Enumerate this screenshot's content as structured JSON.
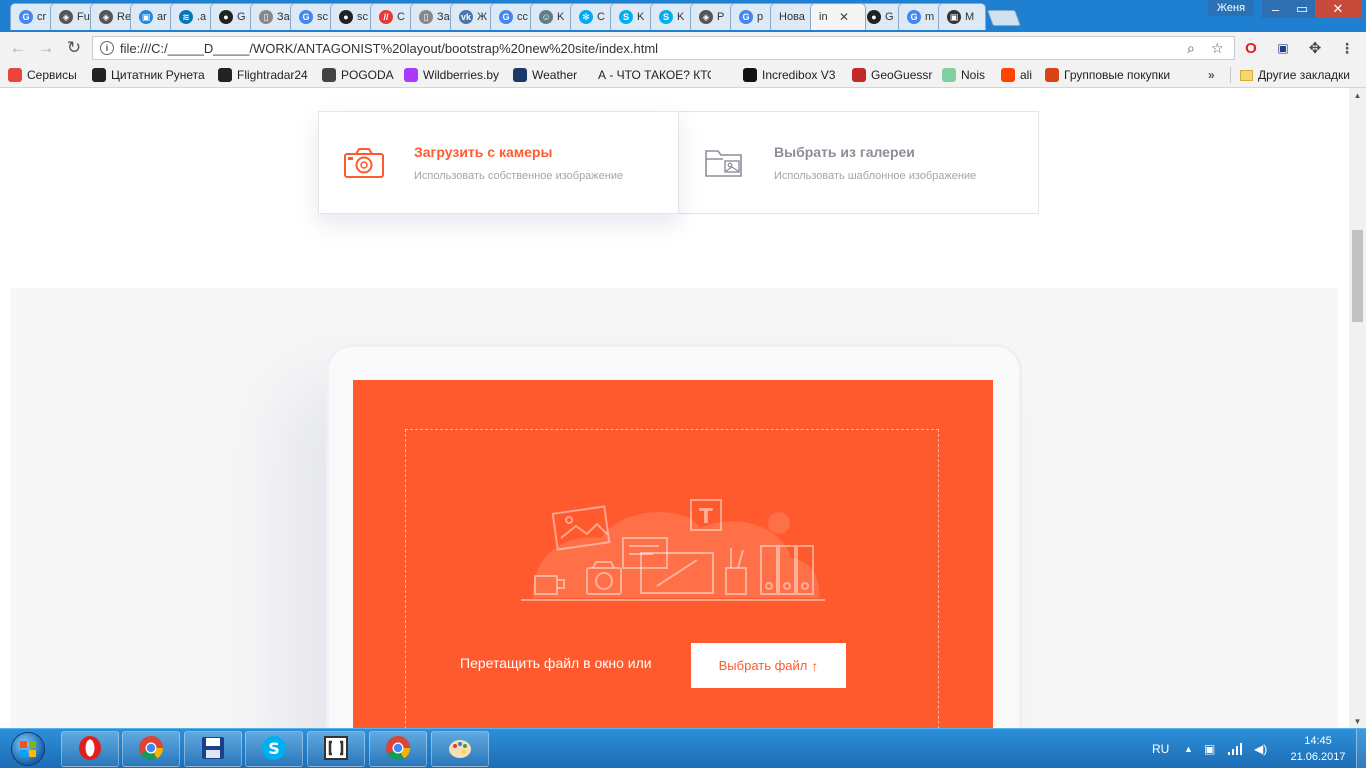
{
  "browser": {
    "tabs": [
      {
        "label": "cr",
        "icon": "google-icon",
        "color": "#4285f4",
        "glyph": "G"
      },
      {
        "label": "Fu",
        "icon": "codepen-icon",
        "color": "#555555",
        "glyph": "◈"
      },
      {
        "label": "Re",
        "icon": "codepen-icon",
        "color": "#555555",
        "glyph": "◈"
      },
      {
        "label": "ar",
        "icon": "image-icon",
        "color": "#1e88e5",
        "glyph": "▣"
      },
      {
        "label": ".a",
        "icon": "wave-icon",
        "color": "#0277bd",
        "glyph": "≋"
      },
      {
        "label": "G",
        "icon": "github-icon",
        "color": "#222222",
        "glyph": "●"
      },
      {
        "label": "За",
        "icon": "document-icon",
        "color": "#888888",
        "glyph": "▯"
      },
      {
        "label": "sc",
        "icon": "google-icon",
        "color": "#4285f4",
        "glyph": "G"
      },
      {
        "label": "sc",
        "icon": "github-icon",
        "color": "#222222",
        "glyph": "●"
      },
      {
        "label": "C",
        "icon": "stripes-icon",
        "color": "#e53935",
        "glyph": "//"
      },
      {
        "label": "За",
        "icon": "document-icon",
        "color": "#888888",
        "glyph": "▯"
      },
      {
        "label": "Ж",
        "icon": "vk-icon",
        "color": "#4a76a8",
        "glyph": "vk"
      },
      {
        "label": "cc",
        "icon": "google-icon",
        "color": "#4285f4",
        "glyph": "G"
      },
      {
        "label": "K",
        "icon": "user-icon",
        "color": "#607d8b",
        "glyph": "☺"
      },
      {
        "label": "C",
        "icon": "gear-icon",
        "color": "#03a9f4",
        "glyph": "✻"
      },
      {
        "label": "K",
        "icon": "skype-icon",
        "color": "#00aff0",
        "glyph": "S"
      },
      {
        "label": "K",
        "icon": "skype-icon",
        "color": "#00aff0",
        "glyph": "S"
      },
      {
        "label": "P",
        "icon": "codepen-icon",
        "color": "#555555",
        "glyph": "◈"
      },
      {
        "label": "p",
        "icon": "google-icon",
        "color": "#4285f4",
        "glyph": "G"
      },
      {
        "label": "Нова",
        "icon": "",
        "color": "#999999",
        "glyph": ""
      },
      {
        "label": "in",
        "icon": "",
        "color": "#999999",
        "glyph": "",
        "active": true
      },
      {
        "label": "G",
        "icon": "github-icon",
        "color": "#222222",
        "glyph": "●"
      },
      {
        "label": "m",
        "icon": "google-icon",
        "color": "#4285f4",
        "glyph": "G"
      },
      {
        "label": "M",
        "icon": "image-icon",
        "color": "#333333",
        "glyph": "▣"
      }
    ],
    "user_name": "Женя",
    "url": "file:///C:/_____D_____/WORK/ANTAGONIST%20layout/bootstrap%20new%20site/index.html",
    "bookmarks": [
      {
        "label": "Сервисы",
        "icon": "apps-icon",
        "color": "#e8453c"
      },
      {
        "label": "Цитатник Рунета",
        "icon": "bash-icon",
        "color": "#222222"
      },
      {
        "label": "Flightradar24",
        "icon": "radar-icon",
        "color": "#222222"
      },
      {
        "label": "POGODA",
        "icon": "weather-small-icon",
        "color": "#444444"
      },
      {
        "label": "Wildberries.by",
        "icon": "wildberries-icon",
        "color": "#a73afd"
      },
      {
        "label": "Weather",
        "icon": "weather-icon",
        "color": "#1a3a6a"
      },
      {
        "label": "А - ЧТО ТАКОЕ? КТО",
        "icon": "page-icon",
        "color": "#666666"
      },
      {
        "label": "Incredibox V3",
        "icon": "music-icon",
        "color": "#111111"
      },
      {
        "label": "GeoGuessr",
        "icon": "pin-icon",
        "color": "#c62828"
      },
      {
        "label": "Nois",
        "icon": "noise-icon",
        "color": "#7fcf9f"
      },
      {
        "label": "ali",
        "icon": "ali-icon",
        "color": "#ff4400"
      },
      {
        "label": "Групповые покупки",
        "icon": "group-icon",
        "color": "#d84315"
      }
    ],
    "other_bookmarks": "Другие закладки"
  },
  "page": {
    "options": [
      {
        "title": "Загрузить с камеры",
        "subtitle": "Использовать собственное изображение",
        "title_color": "#ff5a2d",
        "icon": "camera-icon"
      },
      {
        "title": "Выбрать из галереи",
        "subtitle": "Использовать шаблонное изображение",
        "title_color": "#8c8f99",
        "icon": "gallery-folder-icon"
      }
    ],
    "dropzone": {
      "drag_text": "Перетащить файл в окно или",
      "button_label": "Выбрать файл",
      "accent": "#ff5a2d"
    }
  },
  "taskbar": {
    "apps": [
      {
        "name": "opera",
        "icon": "opera-icon"
      },
      {
        "name": "chrome",
        "icon": "chrome-icon"
      },
      {
        "name": "save",
        "icon": "floppy-icon"
      },
      {
        "name": "skype",
        "icon": "skype-icon"
      },
      {
        "name": "bracket",
        "icon": "brackets-icon"
      },
      {
        "name": "chrome",
        "icon": "chrome-icon"
      },
      {
        "name": "paint",
        "icon": "palette-icon"
      }
    ],
    "language": "RU",
    "time": "14:45",
    "date": "21.06.2017"
  }
}
